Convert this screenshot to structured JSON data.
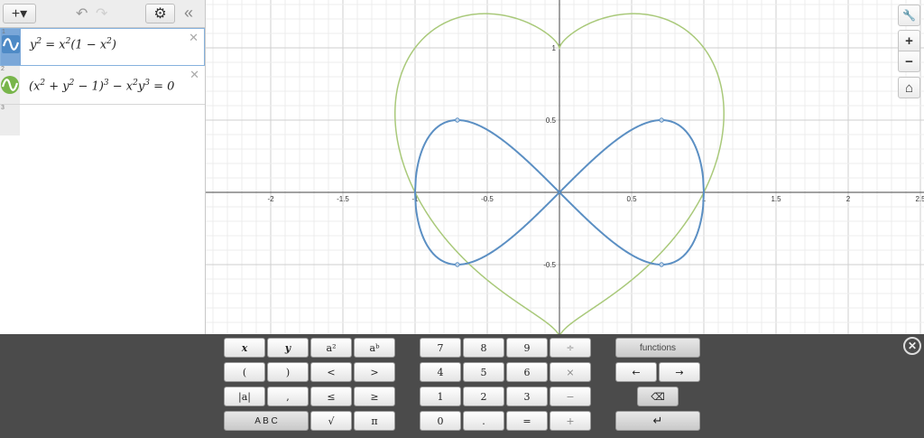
{
  "toolbar": {
    "add_label": "+▾",
    "undo_label": "↶",
    "redo_label": "↷",
    "settings_label": "⚙",
    "collapse_label": "«"
  },
  "expressions": [
    {
      "index": "1",
      "color": "#4e8ac6",
      "icon": "wave-icon",
      "latex_parts": [
        "y",
        "2",
        " = x",
        "2",
        "(1 − x",
        "2",
        ")"
      ]
    },
    {
      "index": "2",
      "color": "#78b54b",
      "icon": "wave-icon",
      "latex_parts": [
        "(x",
        "2",
        " + y",
        "2",
        " − 1)",
        "3",
        " − x",
        "2",
        "y",
        "3",
        " = 0"
      ]
    },
    {
      "index": "3"
    }
  ],
  "graph": {
    "x_ticks": [
      "-2",
      "-1.5",
      "-1",
      "-0.5",
      "0.5",
      "1",
      "1.5",
      "2",
      "2.5"
    ],
    "y_ticks": [
      "1",
      "0.5",
      "-0.5"
    ],
    "x_tick_values": [
      -2,
      -1.5,
      -1,
      -0.5,
      0.5,
      1,
      1.5,
      2,
      2.5
    ],
    "y_tick_values": [
      1,
      0.5,
      -0.5
    ],
    "curve_colors": {
      "lemniscate": "#5b8fc3",
      "heart": "#a9c97a"
    }
  },
  "side_controls": {
    "wrench": "🔧",
    "zoom_in": "+",
    "zoom_out": "−",
    "home": "⌂"
  },
  "keypad": {
    "close_label": "✕",
    "keys": [
      [
        "x",
        "y",
        "a²",
        "aᵇ"
      ],
      [
        "(",
        ")",
        "<",
        ">"
      ],
      [
        "|a|",
        ",",
        "≤",
        "≥"
      ],
      [
        "A B C",
        "√",
        "π"
      ],
      [
        "7",
        "8",
        "9",
        "÷"
      ],
      [
        "4",
        "5",
        "6",
        "×"
      ],
      [
        "1",
        "2",
        "3",
        "−"
      ],
      [
        "0",
        ".",
        "=",
        "+"
      ],
      [
        "functions"
      ],
      [
        "←",
        "→"
      ],
      [
        "⌫"
      ],
      [
        "↵"
      ]
    ]
  }
}
